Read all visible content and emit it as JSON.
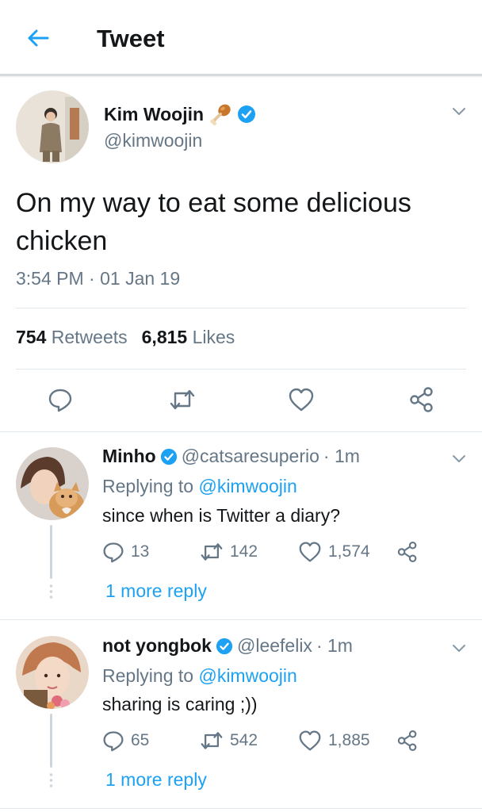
{
  "header": {
    "title": "Tweet"
  },
  "tweet": {
    "name": "Kim Woojin",
    "handle": "@kimwoojin",
    "text": "On my way to eat some delicious chicken",
    "timestamp": "3:54 PM · 01 Jan 19",
    "retweets_count": "754",
    "retweets_label": "Retweets",
    "likes_count": "6,815",
    "likes_label": "Likes"
  },
  "replies": [
    {
      "name": "Minho",
      "handle": "@catsaresuperio",
      "time": "· 1m",
      "replying_prefix": "Replying to",
      "replying_handle": "@kimwoojin",
      "text": "since when is Twitter a diary?",
      "reply_count": "13",
      "retweet_count": "142",
      "like_count": "1,574",
      "more_label": "1 more reply"
    },
    {
      "name": "not yongbok",
      "handle": "@leefelix",
      "time": "· 1m",
      "replying_prefix": "Replying to",
      "replying_handle": "@kimwoojin",
      "text": "sharing is caring ;))",
      "reply_count": "65",
      "retweet_count": "542",
      "like_count": "1,885",
      "more_label": "1 more reply"
    }
  ],
  "colors": {
    "accent": "#1da1f2",
    "verified": "#1da1f2",
    "secondary_text": "#657786",
    "divider": "#e1e8ed"
  },
  "icons": [
    "back-arrow-icon",
    "drumstick-icon",
    "verified-badge-icon",
    "chevron-down-icon",
    "reply-icon",
    "retweet-icon",
    "like-icon",
    "share-icon"
  ]
}
